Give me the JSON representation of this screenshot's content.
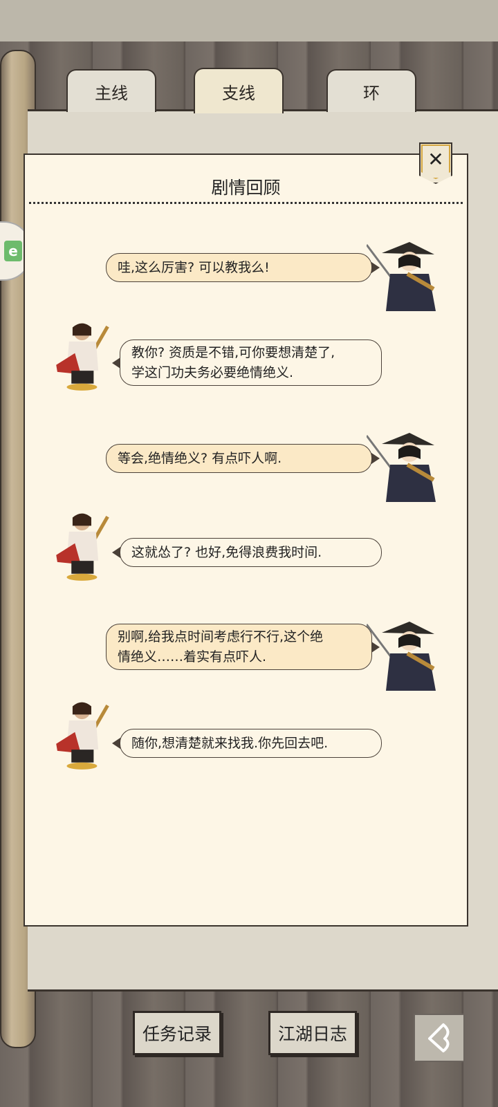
{
  "tabs": [
    {
      "label": "主线",
      "active": false
    },
    {
      "label": "支线",
      "active": true
    },
    {
      "label": "环",
      "active": false
    }
  ],
  "panel": {
    "title": "剧情回顾",
    "close_icon": "close-icon"
  },
  "side_badge": "e",
  "dialogue": [
    {
      "speaker": "player",
      "text": "哇,这么厉害? 可以教我么!"
    },
    {
      "speaker": "master",
      "line1": "教你? 资质是不错,可你要想清楚了,",
      "line2": "学这门功夫务必要绝情绝义."
    },
    {
      "speaker": "player",
      "text": "等会,绝情绝义? 有点吓人啊."
    },
    {
      "speaker": "master",
      "text": "这就怂了? 也好,免得浪费我时间."
    },
    {
      "speaker": "player",
      "line1": "别啊,给我点时间考虑行不行,这个绝",
      "line2": "情绝义……着实有点吓人."
    },
    {
      "speaker": "master",
      "text": "随你,想清楚就来找我.你先回去吧."
    }
  ],
  "bottom": {
    "task_record": "任务记录",
    "jianghu_log": "江湖日志",
    "back_icon": "back-arrow-icon"
  },
  "colors": {
    "panel_bg": "#fdf6e6",
    "player_bubble": "#fbe9c6",
    "outline": "#3a332d"
  }
}
